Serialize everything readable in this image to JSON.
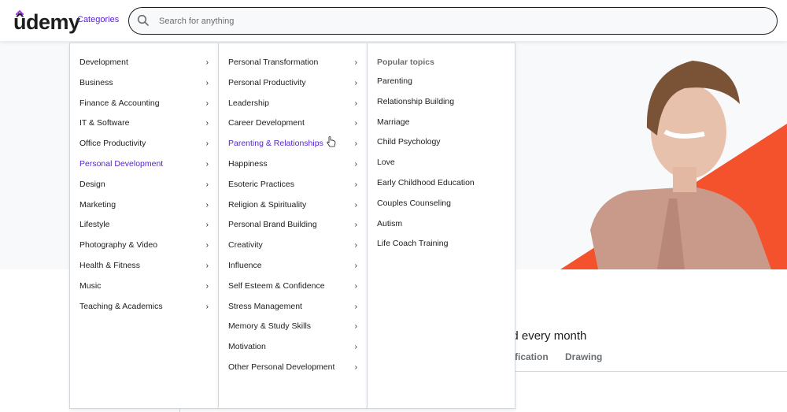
{
  "header": {
    "logo_text": "ûdemy",
    "categories_label": "Categories",
    "search_placeholder": "Search for anything",
    "search_value": ""
  },
  "colors": {
    "brand_purple": "#5624d0",
    "accent_orange": "#f4522d",
    "text_dark": "#1c1d1f",
    "text_muted": "#6a6f73"
  },
  "menu": {
    "categories": [
      {
        "label": "Development"
      },
      {
        "label": "Business"
      },
      {
        "label": "Finance & Accounting"
      },
      {
        "label": "IT & Software"
      },
      {
        "label": "Office Productivity"
      },
      {
        "label": "Personal Development",
        "active": true
      },
      {
        "label": "Design"
      },
      {
        "label": "Marketing"
      },
      {
        "label": "Lifestyle"
      },
      {
        "label": "Photography & Video"
      },
      {
        "label": "Health & Fitness"
      },
      {
        "label": "Music"
      },
      {
        "label": "Teaching & Academics"
      }
    ],
    "subcategories": [
      {
        "label": "Personal Transformation"
      },
      {
        "label": "Personal Productivity"
      },
      {
        "label": "Leadership"
      },
      {
        "label": "Career Development"
      },
      {
        "label": "Parenting & Relationships",
        "active": true
      },
      {
        "label": "Happiness"
      },
      {
        "label": "Esoteric Practices"
      },
      {
        "label": "Religion & Spirituality"
      },
      {
        "label": "Personal Brand Building"
      },
      {
        "label": "Creativity"
      },
      {
        "label": "Influence"
      },
      {
        "label": "Self Esteem & Confidence"
      },
      {
        "label": "Stress Management"
      },
      {
        "label": "Memory & Study Skills"
      },
      {
        "label": "Motivation"
      },
      {
        "label": "Other Personal Development"
      }
    ],
    "popular_title": "Popular topics",
    "popular_topics": [
      "Parenting",
      "Relationship Building",
      "Marriage",
      "Child Psychology",
      "Love",
      "Early Childhood Education",
      "Couples Counseling",
      "Autism",
      "Life Coach Training"
    ]
  },
  "page": {
    "tagline_fragment": "ed every month",
    "tabs_visible": [
      "rtification",
      "Drawing"
    ]
  }
}
